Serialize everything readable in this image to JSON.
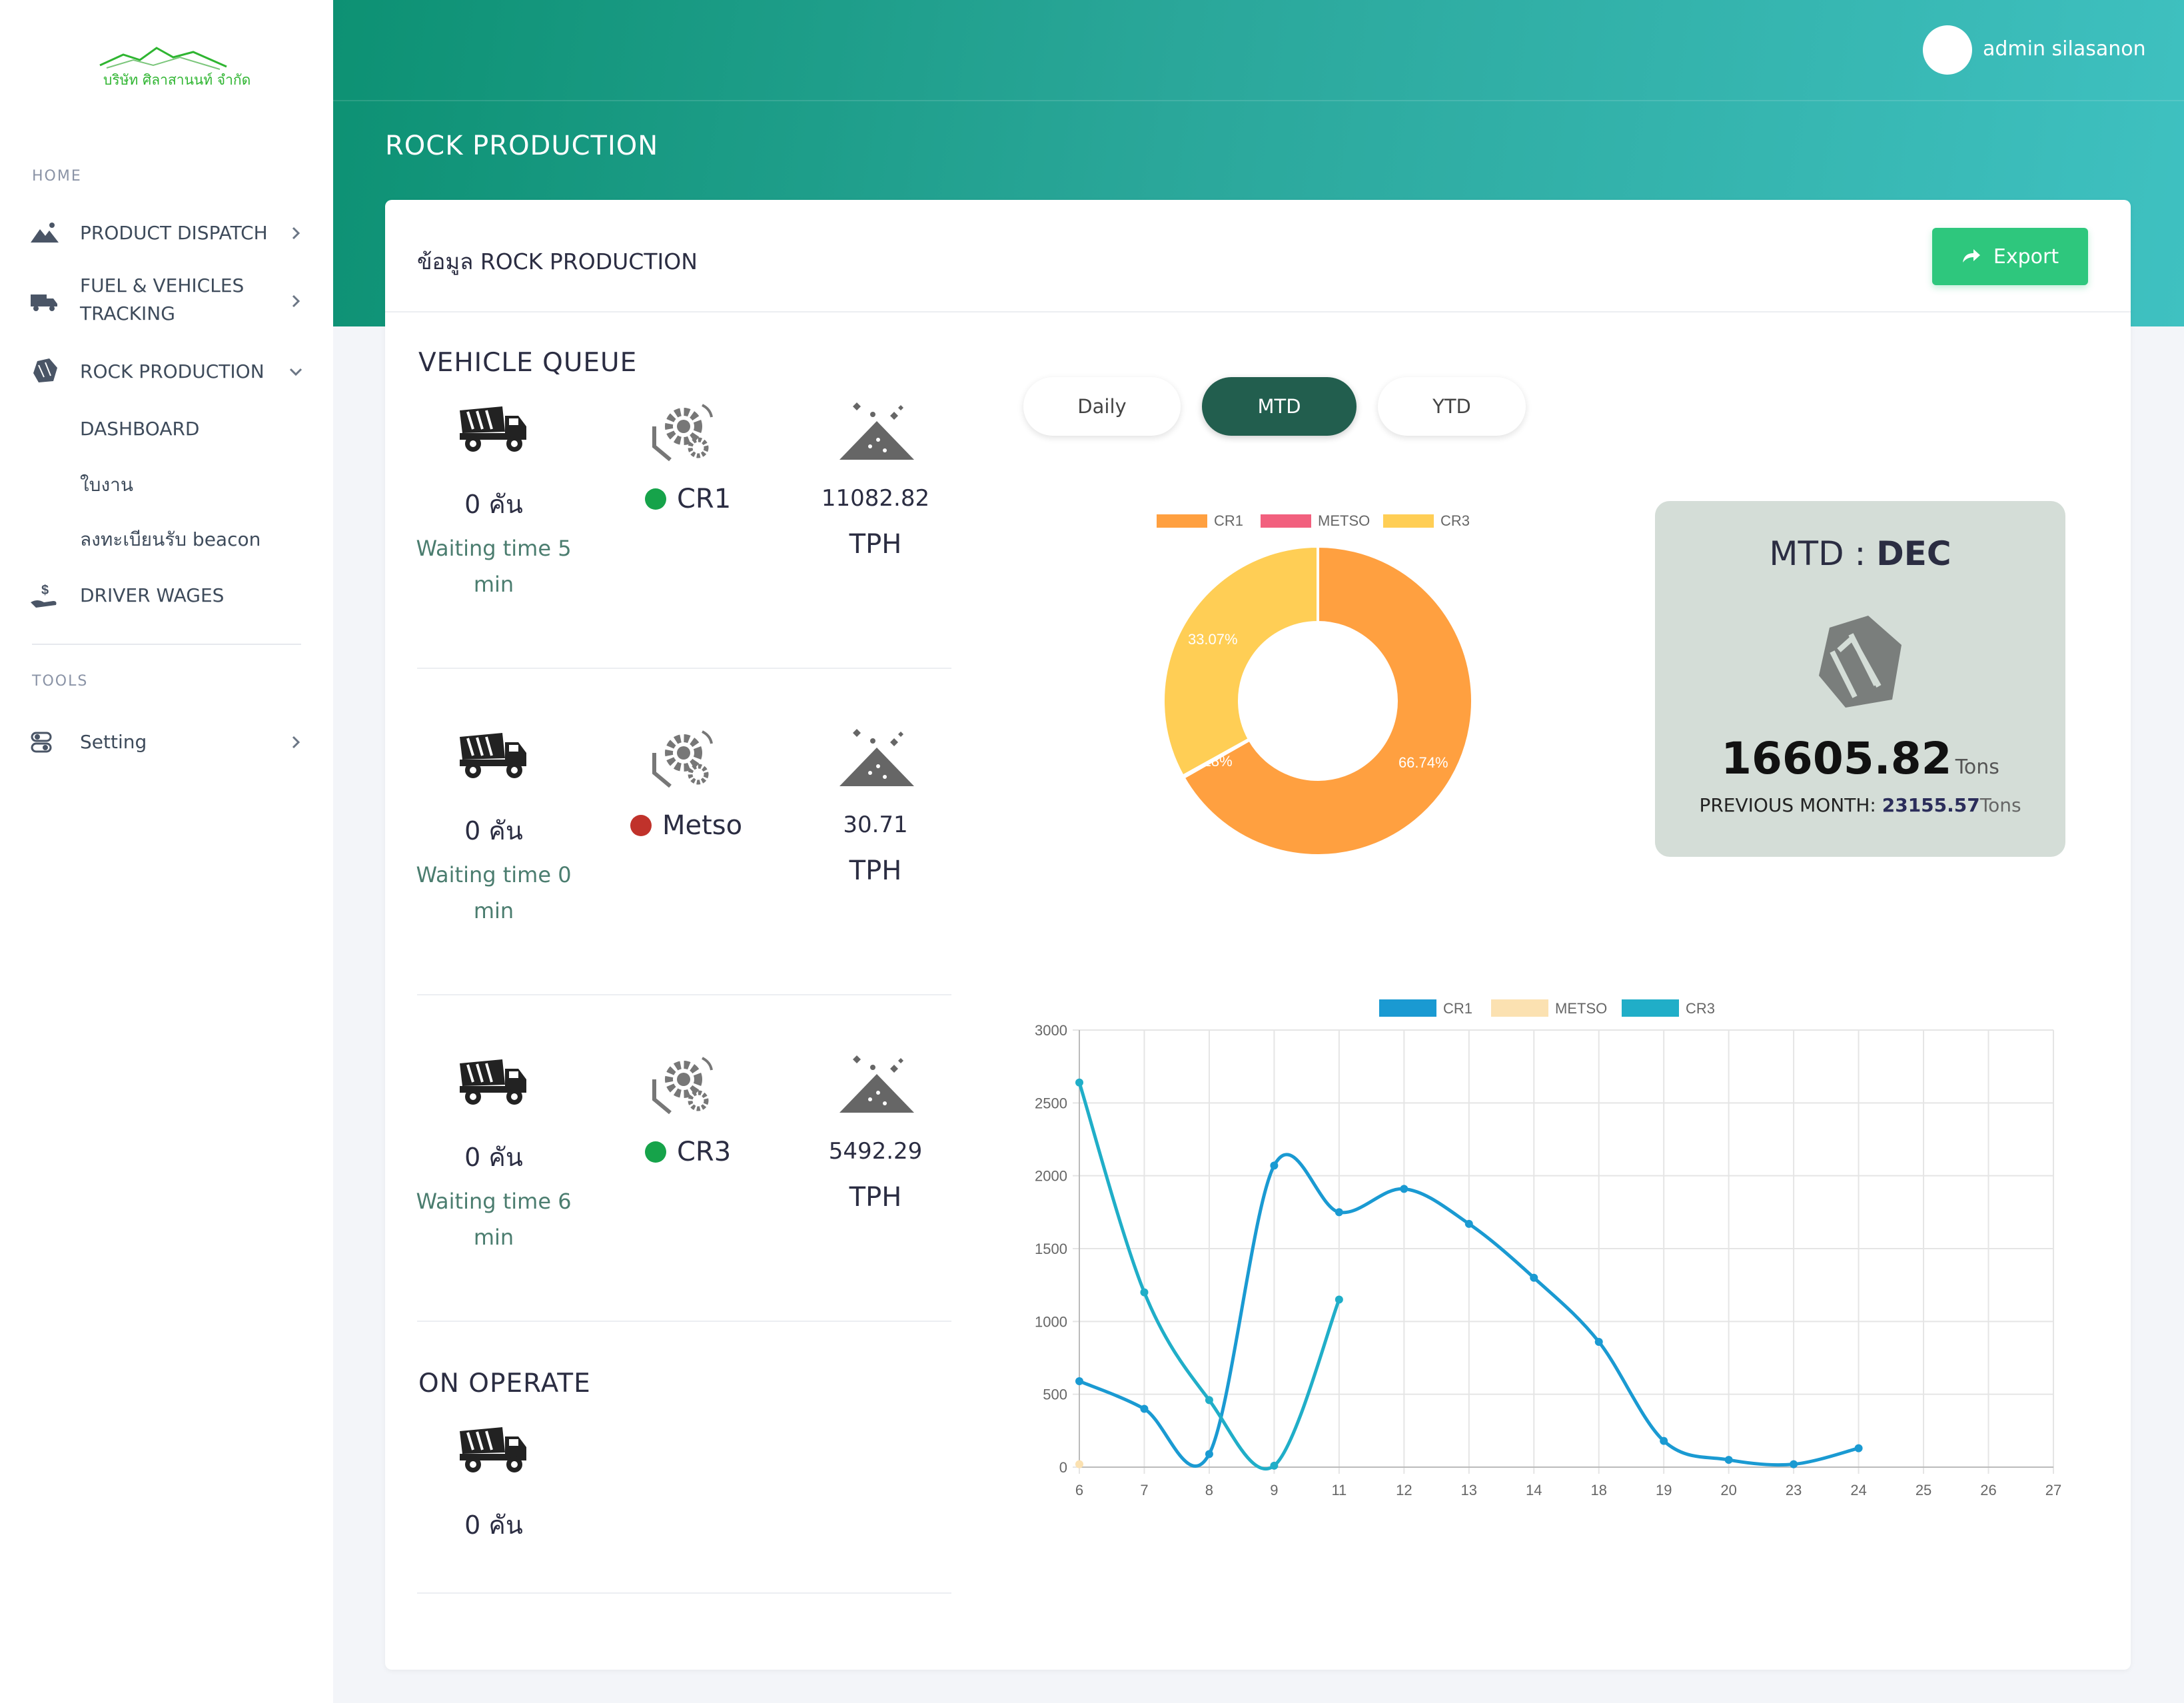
{
  "logo": {
    "company": "บริษัท ศิลาสานนท์ จำกัด"
  },
  "sidebar": {
    "home_section": "HOME",
    "tools_section": "TOOLS",
    "items": [
      {
        "label": "PRODUCT DISPATCH"
      },
      {
        "label_line1": "FUEL & VEHICLES",
        "label_line2": "TRACKING"
      },
      {
        "label": "ROCK PRODUCTION"
      },
      {
        "label": "DASHBOARD"
      },
      {
        "label": "ใบงาน"
      },
      {
        "label": "ลงทะเบียนรับ beacon"
      },
      {
        "label": "DRIVER WAGES"
      },
      {
        "label": "Setting"
      }
    ]
  },
  "header": {
    "user": "admin silasanon",
    "page_title": "ROCK PRODUCTION"
  },
  "card": {
    "title": "ข้อมูล ROCK PRODUCTION",
    "export_label": "Export"
  },
  "vehicle_queue": {
    "title": "VEHICLE QUEUE",
    "rows": [
      {
        "count": "0 คัน",
        "wait_line1": "Waiting time 5",
        "wait_line2": "min",
        "machine": "CR1",
        "status_color": "#16a34a",
        "tph": "11082.82",
        "tph_unit": "TPH"
      },
      {
        "count": "0 คัน",
        "wait_line1": "Waiting time 0",
        "wait_line2": "min",
        "machine": "Metso",
        "status_color": "#c0322b",
        "tph": "30.71",
        "tph_unit": "TPH"
      },
      {
        "count": "0 คัน",
        "wait_line1": "Waiting time 6",
        "wait_line2": "min",
        "machine": "CR3",
        "status_color": "#16a34a",
        "tph": "5492.29",
        "tph_unit": "TPH"
      }
    ]
  },
  "on_operate": {
    "title": "ON OPERATE",
    "count": "0 คัน"
  },
  "tabs": [
    {
      "label": "Daily",
      "active": false
    },
    {
      "label": "MTD",
      "active": true
    },
    {
      "label": "YTD",
      "active": false
    }
  ],
  "mtd": {
    "title_prefix": "MTD : ",
    "month": "DEC",
    "value": "16605.82",
    "unit": "Tons",
    "previous_label": "PREVIOUS MONTH: ",
    "previous_value": "23155.57",
    "previous_unit": "Tons"
  },
  "chart_data": [
    {
      "type": "pie",
      "variant": "doughnut",
      "legend": [
        "CR1",
        "METSO",
        "CR3"
      ],
      "values": [
        66.74,
        0.18,
        33.07
      ],
      "labels": [
        "66.74%",
        "0.18%",
        "33.07%"
      ],
      "colors": [
        "#ffa040",
        "#f2607e",
        "#ffce55"
      ],
      "legend_position": "top"
    },
    {
      "type": "line",
      "x": [
        6,
        7,
        8,
        9,
        11,
        12,
        13,
        14,
        18,
        19,
        20,
        23,
        24,
        25,
        26,
        27
      ],
      "series": [
        {
          "name": "CR1",
          "color": "#1a9ad2",
          "points": [
            [
              6,
              590
            ],
            [
              7,
              400
            ],
            [
              8,
              90
            ],
            [
              9,
              2070
            ],
            [
              11,
              1750
            ],
            [
              12,
              1910
            ],
            [
              13,
              1670
            ],
            [
              14,
              1300
            ],
            [
              18,
              860
            ],
            [
              19,
              180
            ],
            [
              20,
              50
            ],
            [
              23,
              20
            ],
            [
              24,
              130
            ]
          ]
        },
        {
          "name": "METSO",
          "color": "#fbe1b1",
          "points": [
            [
              6,
              20
            ]
          ]
        },
        {
          "name": "CR3",
          "color": "#20aec8",
          "points": [
            [
              6,
              2640
            ],
            [
              7,
              1200
            ],
            [
              8,
              460
            ],
            [
              9,
              10
            ],
            [
              11,
              1150
            ]
          ]
        }
      ],
      "ylim": [
        0,
        3000
      ],
      "yticks": [
        0,
        500,
        1000,
        1500,
        2000,
        2500,
        3000
      ],
      "grid": true,
      "legend_position": "top"
    }
  ]
}
